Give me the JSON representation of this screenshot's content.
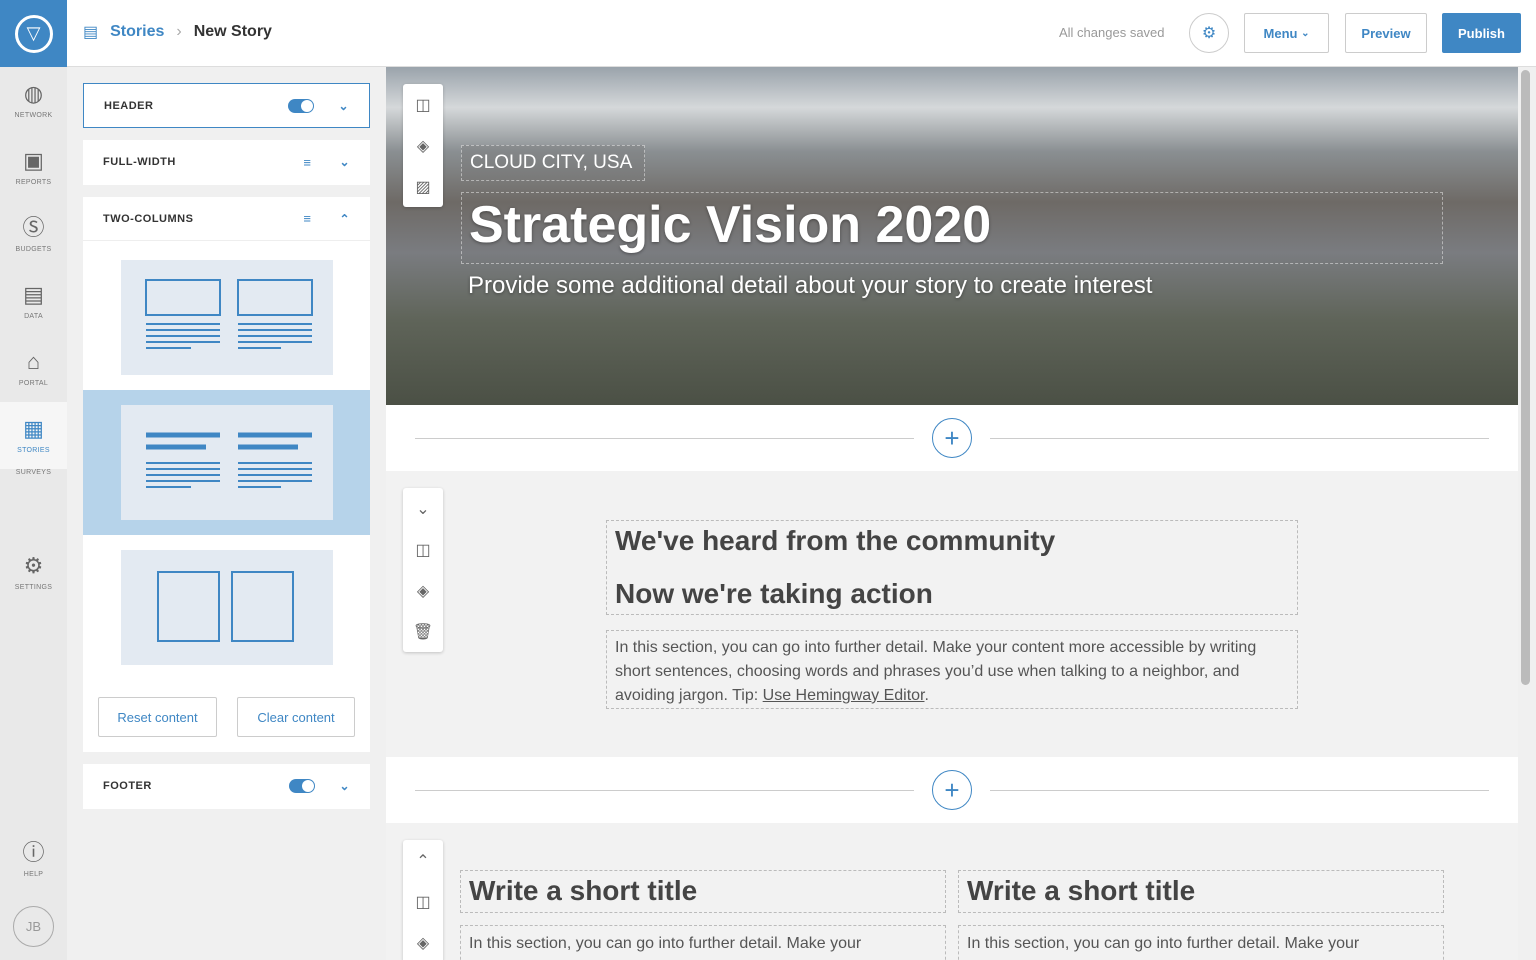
{
  "rail": {
    "items": [
      {
        "label": "NETWORK",
        "icon": "globe-icon"
      },
      {
        "label": "REPORTS",
        "icon": "reports-icon"
      },
      {
        "label": "BUDGETS",
        "icon": "budgets-icon"
      },
      {
        "label": "DATA",
        "icon": "data-icon"
      },
      {
        "label": "PORTAL",
        "icon": "portal-icon"
      },
      {
        "label": "STORIES",
        "icon": "stories-icon"
      },
      {
        "label": "SURVEYS",
        "icon": ""
      },
      {
        "label": "SETTINGS",
        "icon": "gear-icon"
      }
    ],
    "help": "HELP",
    "avatar": "JB"
  },
  "header": {
    "breadcrumb": "Stories",
    "title": "New Story",
    "status": "All changes saved",
    "menu": "Menu",
    "preview": "Preview",
    "publish": "Publish"
  },
  "panel": {
    "header": "HEADER",
    "full_width": "FULL-WIDTH",
    "two_columns": "TWO-COLUMNS",
    "reset": "Reset content",
    "clear": "Clear content",
    "footer": "FOOTER"
  },
  "hero": {
    "location": "CLOUD CITY, USA",
    "title": "Strategic Vision 2020",
    "subtitle": "Provide some additional detail about your story to create interest"
  },
  "section1": {
    "title1": "We've heard from the community",
    "title2": "Now we're taking action",
    "body": "In this section, you can go into further detail. Make your content more accessible by writing short sentences, choosing words and phrases you’d use when talking to a neighbor, and avoiding jargon. Tip: ",
    "link": "Use Hemingway Editor",
    "end": "."
  },
  "section2": {
    "col1_title": "Write a short title",
    "col1_body": "In this section, you can go into further detail. Make your",
    "col2_title": "Write a short title",
    "col2_body": "In this section, you can go into further detail. Make your"
  },
  "colors": {
    "accent": "#3f87c4"
  }
}
